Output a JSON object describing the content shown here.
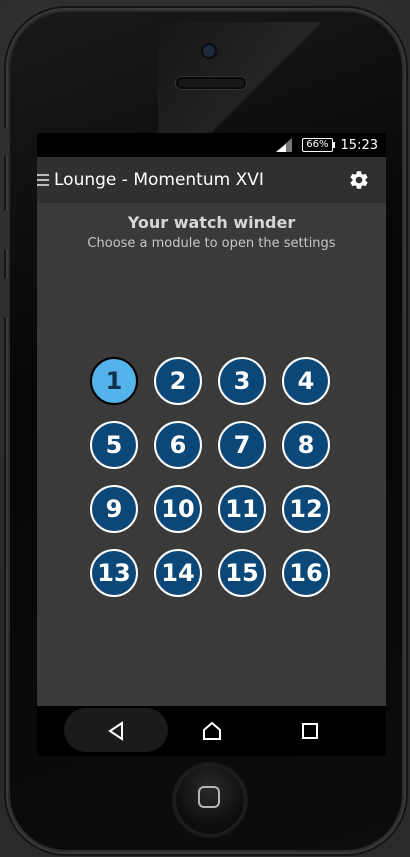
{
  "status": {
    "battery": "66%",
    "time": "15:23"
  },
  "appbar": {
    "title": "Lounge - Momentum XVI"
  },
  "header": {
    "title": "Your watch winder",
    "subtitle": "Choose a module to open the settings"
  },
  "modules": [
    "1",
    "2",
    "3",
    "4",
    "5",
    "6",
    "7",
    "8",
    "9",
    "10",
    "11",
    "12",
    "13",
    "14",
    "15",
    "16"
  ],
  "colors": {
    "module_bg": "#0b4777",
    "module_active_bg": "#54b3ea",
    "screen_bg": "#3a3a3a",
    "appbar_bg": "#303030"
  }
}
